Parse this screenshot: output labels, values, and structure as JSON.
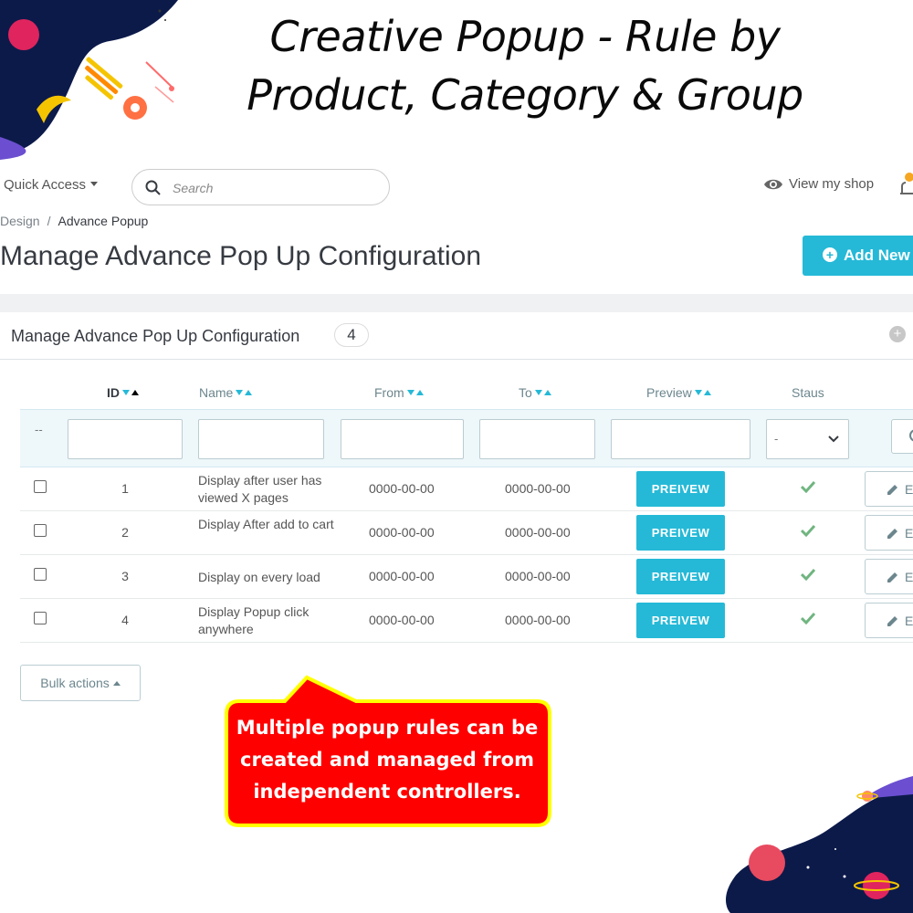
{
  "banner": {
    "line1": "Creative Popup - Rule by",
    "line2": "Product, Category & Group"
  },
  "header": {
    "quick_access": "Quick Access",
    "search_placeholder": "Search",
    "view_shop": "View my shop",
    "notification_count": "1"
  },
  "breadcrumb": {
    "parent": "Design",
    "separator": "/",
    "current": "Advance Popup"
  },
  "page": {
    "title": "Manage Advance Pop Up Configuration",
    "add_new": "Add New"
  },
  "panel": {
    "title": "Manage Advance Pop Up Configuration",
    "count": "4"
  },
  "table": {
    "columns": {
      "id": "ID",
      "name": "Name",
      "from": "From",
      "to": "To",
      "preview": "Preview",
      "status": "Staus"
    },
    "filter": {
      "dash": "--",
      "status_selected": "-"
    },
    "rows": [
      {
        "id": "1",
        "name": "Display after user has viewed X pages",
        "from": "0000-00-00",
        "to": "0000-00-00",
        "preview": "PREIVEW",
        "edit": "E"
      },
      {
        "id": "2",
        "name": "Display After add to cart",
        "from": "0000-00-00",
        "to": "0000-00-00",
        "preview": "PREIVEW",
        "edit": "E"
      },
      {
        "id": "3",
        "name": "Display on every load",
        "from": "0000-00-00",
        "to": "0000-00-00",
        "preview": "PREIVEW",
        "edit": "E"
      },
      {
        "id": "4",
        "name": "Display Popup click anywhere",
        "from": "0000-00-00",
        "to": "0000-00-00",
        "preview": "PREIVEW",
        "edit": "E"
      }
    ]
  },
  "bulk_actions": "Bulk actions",
  "callout": {
    "line1": "Multiple popup rules can be",
    "line2": "created and managed from",
    "line3": "independent controllers."
  },
  "colors": {
    "accent": "#25b9d7",
    "status_check": "#70b580",
    "callout_fill": "#ff0000",
    "callout_border": "#ffff00"
  }
}
